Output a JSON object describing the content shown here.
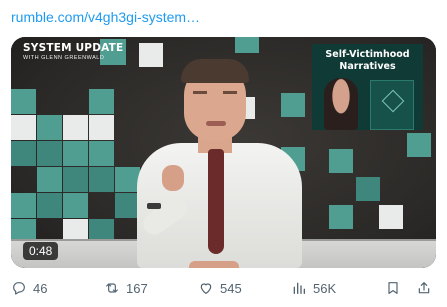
{
  "link": {
    "text": "rumble.com/v4gh3gi-system…"
  },
  "video": {
    "logo_main": "SYSTEM UPDATE",
    "logo_sub": "WITH GLENN GREENWALD",
    "inset_title_line1": "Self-Victimhood",
    "inset_title_line2": "Narratives",
    "duration": "0:48"
  },
  "actions": {
    "replies": "46",
    "reposts": "167",
    "likes": "545",
    "views": "56K"
  },
  "icons": {
    "replies": "reply-icon",
    "reposts": "repost-icon",
    "likes": "heart-icon",
    "views": "bar-chart-icon",
    "bookmark": "bookmark-icon",
    "share": "share-icon"
  },
  "colors": {
    "link": "#1d9bf0",
    "action_text": "#536471",
    "tile_teal": "#4f9e91"
  }
}
